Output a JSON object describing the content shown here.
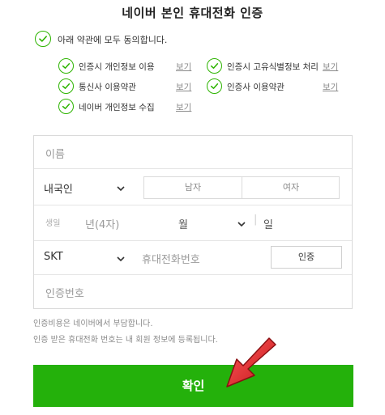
{
  "title": "네이버 본인 휴대전화 인증",
  "agree_all": "아래 약관에 모두 동의합니다.",
  "view_label": "보기",
  "terms": [
    {
      "label": "인증시 개인정보 이용"
    },
    {
      "label": "인증시 고유식별정보 처리"
    },
    {
      "label": "통신사 이용약관"
    },
    {
      "label": "인증사 이용약관"
    },
    {
      "label": "네이버 개인정보 수집"
    }
  ],
  "form": {
    "name_placeholder": "이름",
    "nationality_value": "내국인",
    "gender_male": "남자",
    "gender_female": "여자",
    "birth_label": "생일",
    "year_placeholder": "년(4자)",
    "month_placeholder": "월",
    "day_placeholder": "일",
    "carrier_value": "SKT",
    "phone_placeholder": "휴대전화번호",
    "auth_button": "인증",
    "code_placeholder": "인증번호"
  },
  "notes": [
    "인증비용은 네이버에서 부담합니다.",
    "인증 받은 휴대전화 번호는 내 회원 정보에 등록됩니다."
  ],
  "confirm_button": "확인",
  "colors": {
    "accent": "#24b10b",
    "check_green": "#2db400",
    "arrow_red": "#e8262b"
  }
}
